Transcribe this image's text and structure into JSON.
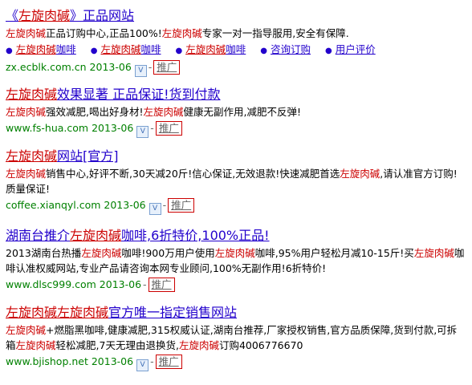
{
  "results": [
    {
      "title_prefix": "《",
      "title_hl": "左旋肉碱",
      "title_rest": "》正品网站",
      "desc": [
        {
          "t": "左旋肉碱",
          "hl": true
        },
        {
          "t": "正品订购中心,正品100%!",
          "hl": false
        },
        {
          "t": "左旋肉碱",
          "hl": true
        },
        {
          "t": "专家一对一指导服用,安全有保障.",
          "hl": false
        }
      ],
      "sublinks": [
        {
          "hl": "左旋肉碱",
          "rest": "咖啡"
        },
        {
          "hl": "左旋肉碱",
          "rest": "咖啡"
        },
        {
          "hl": "左旋肉碱",
          "rest": "咖啡"
        },
        {
          "hl": "",
          "rest": "咨询订购"
        },
        {
          "hl": "",
          "rest": "用户评价"
        }
      ],
      "url": "zx.ecblk.com.cn 2013-06",
      "promo": "推广"
    },
    {
      "title_prefix": "",
      "title_hl": "左旋肉碱",
      "title_rest": "效果显著 正品保证!货到付款",
      "desc": [
        {
          "t": "左旋肉碱",
          "hl": true
        },
        {
          "t": "强效减肥,喝出好身材!",
          "hl": false
        },
        {
          "t": "左旋肉碱",
          "hl": true
        },
        {
          "t": "健康无副作用,减肥不反弹!",
          "hl": false
        }
      ],
      "url": "www.fs-hua.com 2013-06",
      "promo": "推广"
    },
    {
      "title_prefix": "",
      "title_hl": "左旋肉碱",
      "title_rest": "网站[官方]",
      "desc": [
        {
          "t": "左旋肉碱",
          "hl": true
        },
        {
          "t": "销售中心,好评不断,30天减20斤!信心保证,无效退款!快速减肥首选",
          "hl": false
        },
        {
          "t": "左旋肉碱",
          "hl": true
        },
        {
          "t": ",请认准官方订购!质量保证!",
          "hl": false
        }
      ],
      "url": "coffee.xianqyl.com 2013-06",
      "promo": "推广"
    },
    {
      "title_prefix": "湖南台推介",
      "title_hl": "左旋肉碱",
      "title_rest": "咖啡,6折特价,100%正品!",
      "desc": [
        {
          "t": "2013湖南台热播",
          "hl": false
        },
        {
          "t": "左旋肉碱",
          "hl": true
        },
        {
          "t": "咖啡!900万用户使用",
          "hl": false
        },
        {
          "t": "左旋肉碱",
          "hl": true
        },
        {
          "t": "咖啡,95%用户轻松月减10-15斤!买",
          "hl": false
        },
        {
          "t": "左旋肉碱",
          "hl": true
        },
        {
          "t": "咖啡认准权威网站,专业产品请咨询本网专业顾问,100%无副作用!6折特价!",
          "hl": false
        }
      ],
      "url": "www.dlsc999.com 2013-06",
      "promo": "推广"
    },
    {
      "title_prefix": "",
      "title_hl": "左旋肉碱左旋肉碱",
      "title_rest": "官方唯一指定销售网站",
      "desc": [
        {
          "t": "左旋肉碱",
          "hl": true
        },
        {
          "t": "+燃脂黑咖啡,健康减肥,315权威认证,湖南台推荐,厂家授权销售,官方品质保障,货到付款,可拆箱",
          "hl": false
        },
        {
          "t": "左旋肉碱",
          "hl": true
        },
        {
          "t": "轻松减肥,7天无理由退换货,",
          "hl": false
        },
        {
          "t": "左旋肉碱",
          "hl": true
        },
        {
          "t": "订购4006776670",
          "hl": false
        }
      ],
      "url": "www.bjishop.net 2013-06",
      "promo": "推广"
    }
  ],
  "vicon_label": "V",
  "separator": "-",
  "bullet_glyph": "●"
}
